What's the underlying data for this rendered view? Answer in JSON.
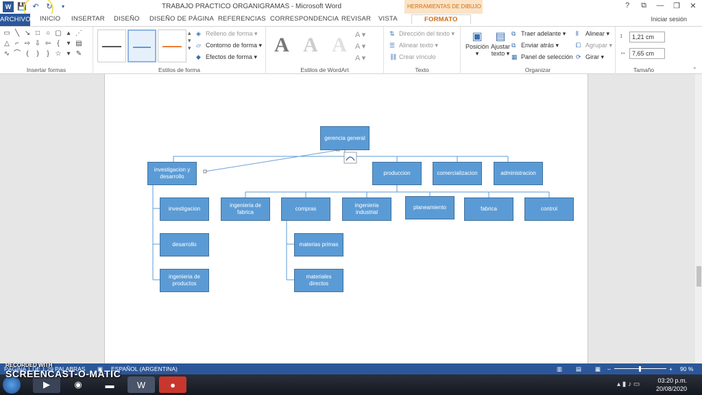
{
  "titlebar": {
    "title": "TRABAJO PRACTICO ORGANIGRAMAS - Microsoft Word",
    "help": "?",
    "controls": [
      "⧉",
      "—",
      "❐",
      "✕"
    ]
  },
  "tabs": {
    "file": "ARCHIVO",
    "items": [
      "INICIO",
      "INSERTAR",
      "DISEÑO",
      "DISEÑO DE PÁGINA",
      "REFERENCIAS",
      "CORRESPONDENCIA",
      "REVISAR",
      "VISTA"
    ],
    "context_header": "HERRAMIENTAS DE DIBUJO",
    "active": "FORMATO",
    "signin": "Iniciar sesión"
  },
  "ribbon": {
    "groups": {
      "insert_shapes": "Insertar formas",
      "shape_styles": "Estilos de forma",
      "wordart_styles": "Estilos de WordArt",
      "text": "Texto",
      "arrange": "Organizar",
      "size": "Tamaño"
    },
    "shape_style": {
      "fill": "Relleno de forma",
      "outline": "Contorno de forma",
      "effects": "Efectos de forma"
    },
    "text": {
      "direction": "Dirección del texto",
      "align": "Alinear texto",
      "link": "Crear vínculo"
    },
    "arrange": {
      "position": "Posición",
      "wrap_1": "Ajustar",
      "wrap_2": "texto",
      "bring_forward": "Traer adelante",
      "send_backward": "Enviar atrás",
      "selection_pane": "Panel de selección",
      "align": "Alinear",
      "group": "Agrupar",
      "rotate": "Girar"
    },
    "size": {
      "height": "1,21 cm",
      "width": "7,65 cm"
    },
    "wordart_letter": "A"
  },
  "chart": {
    "nodes": {
      "gerencia": "gerencia general",
      "investigacion_desarrollo": "investigacion y desarrollo",
      "produccion": "produccion",
      "comercializacion": "comercializacion",
      "administracion": "administracion",
      "investigacion": "investigacion",
      "desarrollo": "desarrollo",
      "ingenieria_productos": "ingenieria de productos",
      "ingenieria_fabrica": "ingenieria de fabrica",
      "compras": "compras",
      "ingenieria_industrial": "ingenieria industrial",
      "planeamiento": "planeamiento",
      "fabrica": "fabrica",
      "control": "control",
      "materias_primas": "materias primas",
      "materiales_directos": "materiales directos"
    }
  },
  "statusbar": {
    "page_words": "PÁGINA 1 DE 1    29 PALABRAS",
    "language": "ESPAÑOL (ARGENTINA)",
    "zoom": "90 %"
  },
  "watermark": {
    "line1": "RECORDED WITH",
    "line2": "SCREENCAST-O-MATIC"
  },
  "taskbar": {
    "time": "03:20 p.m.",
    "date": "20/08/2020"
  }
}
